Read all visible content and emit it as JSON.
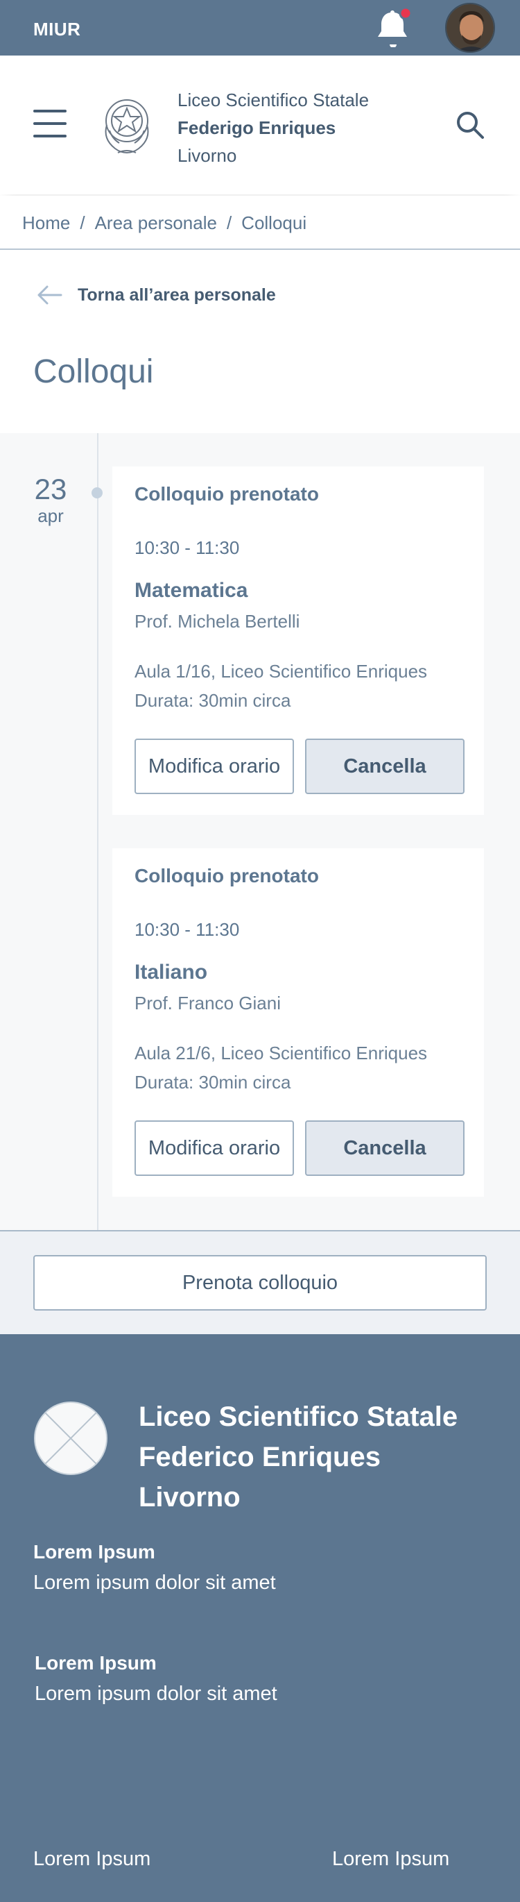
{
  "topbar": {
    "brand": "MIUR",
    "notification_color": "#e8364e"
  },
  "header": {
    "school_line1": "Liceo Scientifico Statale",
    "school_line2": "Federigo Enriques",
    "school_line3": "Livorno"
  },
  "breadcrumb": {
    "items": [
      "Home",
      "Area personale",
      "Colloqui"
    ]
  },
  "back_link": {
    "label": "Torna all’area personale"
  },
  "page": {
    "title": "Colloqui"
  },
  "date": {
    "day": "23",
    "month": "apr"
  },
  "appointments": [
    {
      "status": "Colloquio prenotato",
      "time": "10:30 - 11:30",
      "subject": "Matematica",
      "teacher": "Prof. Michela Bertelli",
      "place": "Aula 1/16, Liceo Scientifico Enriques",
      "duration": "Durata: 30min circa",
      "modify_label": "Modifica orario",
      "cancel_label": "Cancella"
    },
    {
      "status": "Colloquio prenotato",
      "time": "10:30 - 11:30",
      "subject": "Italiano",
      "teacher": "Prof. Franco Giani",
      "place": "Aula 21/6, Liceo Scientifico Enriques",
      "duration": "Durata: 30min circa",
      "modify_label": "Modifica orario",
      "cancel_label": "Cancella"
    }
  ],
  "book": {
    "label": "Prenota colloquio"
  },
  "footer": {
    "name_line1": "Liceo Scientifico Statale",
    "name_line2": "Federico Enriques",
    "name_line3": "Livorno",
    "blocks": [
      {
        "heading": "Lorem Ipsum",
        "text": "Lorem ipsum dolor sit amet"
      },
      {
        "heading": "Lorem Ipsum",
        "text": "Lorem ipsum dolor sit amet"
      }
    ],
    "links": [
      "Lorem Ipsum",
      "Lorem Ipsum"
    ]
  }
}
